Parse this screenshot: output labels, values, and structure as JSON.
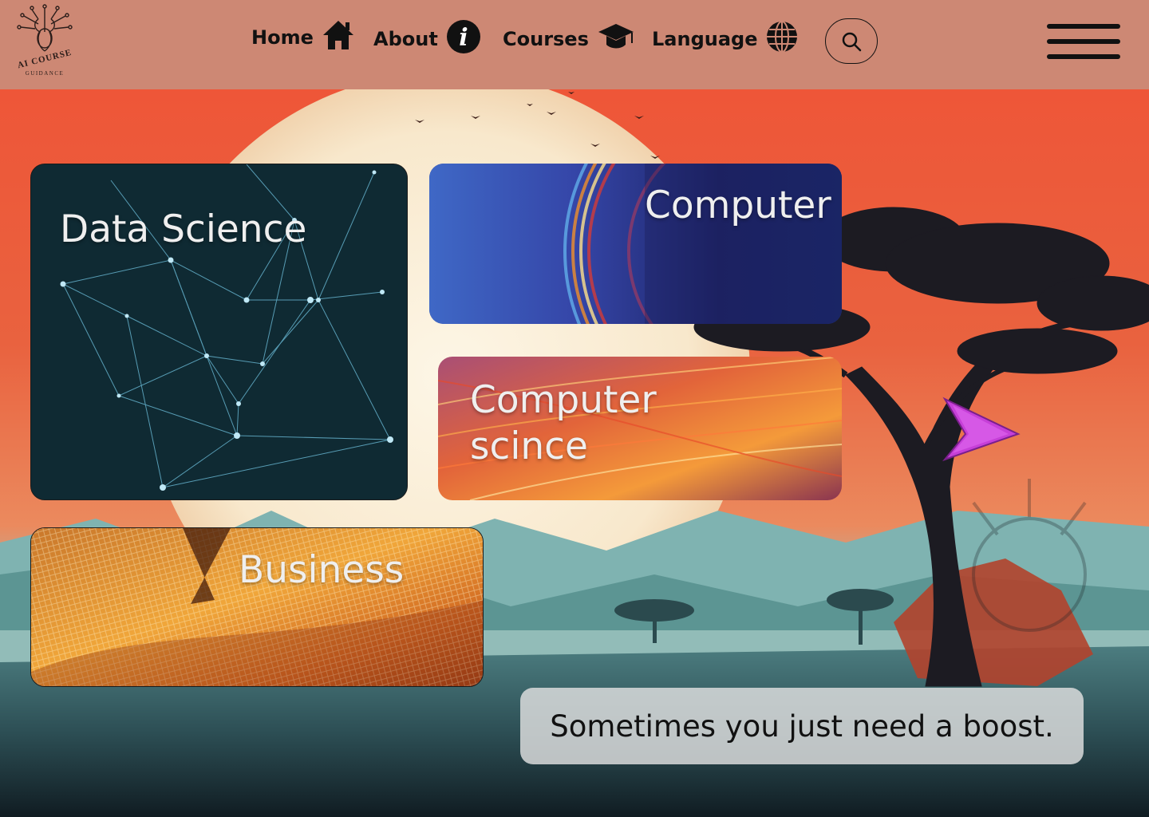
{
  "logo": {
    "main": "AI COURSE",
    "sub": "GUIDANCE"
  },
  "nav": {
    "home": {
      "label": "Home",
      "icon": "home-icon"
    },
    "about": {
      "label": "About",
      "icon": "info-icon"
    },
    "courses": {
      "label": "Courses",
      "icon": "graduation-cap-icon"
    },
    "language": {
      "label": "Language",
      "icon": "globe-icon"
    },
    "search_icon": "search-icon",
    "menu_icon": "hamburger-menu-icon"
  },
  "cards": {
    "data_science": "Data Science",
    "computer": "Computer",
    "computer_science": "Computer\nscince",
    "business": "Business"
  },
  "next_icon": "chevron-right-icon",
  "tagline": "Sometimes you just need a boost.",
  "colors": {
    "header": "#cd8874",
    "sky_top": "#ee5638",
    "sun": "#f7e6c8",
    "next_arrow": "#c63fd8"
  }
}
